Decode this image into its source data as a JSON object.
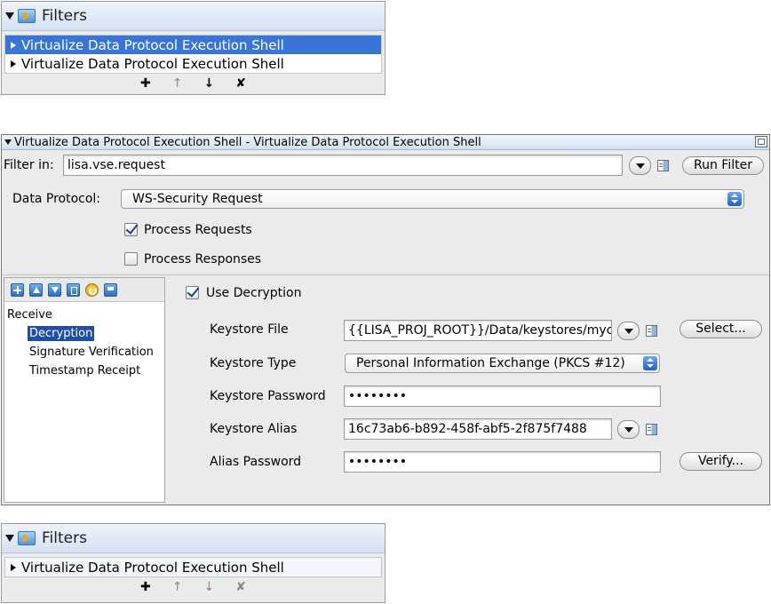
{
  "filters_top": {
    "title": "Filters",
    "items": [
      {
        "label": "Virtualize Data Protocol Execution Shell",
        "selected": true
      },
      {
        "label": "Virtualize Data Protocol Execution Shell",
        "selected": false
      }
    ],
    "tools": {
      "add": "✚",
      "up": "↑",
      "down": "↓",
      "delete": "✘"
    }
  },
  "editor": {
    "title": "Virtualize Data Protocol Execution Shell - Virtualize Data Protocol Execution Shell",
    "filter_in_label": "Filter in:",
    "filter_in_value": "lisa.vse.request",
    "run_filter_label": "Run Filter",
    "data_protocol_label": "Data Protocol:",
    "data_protocol_value": "WS-Security Request",
    "process_requests_label": "Process Requests",
    "process_requests_checked": true,
    "process_responses_label": "Process Responses",
    "process_responses_checked": false,
    "tree": {
      "root": "Receive",
      "children": [
        "Decryption",
        "Signature Verification",
        "Timestamp Receipt"
      ],
      "selected": "Decryption"
    },
    "decryption": {
      "use_decryption_label": "Use Decryption",
      "use_decryption_checked": true,
      "keystore_file_label": "Keystore File",
      "keystore_file_value": "{{LISA_PROJ_ROOT}}/Data/keystores/myc",
      "select_label": "Select...",
      "keystore_type_label": "Keystore Type",
      "keystore_type_value": "Personal Information Exchange (PKCS #12)",
      "keystore_password_label": "Keystore Password",
      "keystore_password_value": "••••••••",
      "keystore_alias_label": "Keystore Alias",
      "keystore_alias_value": "16c73ab6-b892-458f-abf5-2f875f7488",
      "alias_password_label": "Alias Password",
      "alias_password_value": "••••••••",
      "verify_label": "Verify..."
    }
  },
  "filters_bottom": {
    "title": "Filters",
    "items": [
      {
        "label": "Virtualize Data Protocol Execution Shell",
        "selected": false
      }
    ],
    "tools": {
      "add": "✚",
      "up": "↑",
      "down": "↓",
      "delete": "✘"
    }
  },
  "colors": {
    "selection": "#3875d7",
    "tree_selection": "#1e4ea8",
    "header_gradient_top": "#eef3fb",
    "header_gradient_bottom": "#d4e1f3"
  }
}
